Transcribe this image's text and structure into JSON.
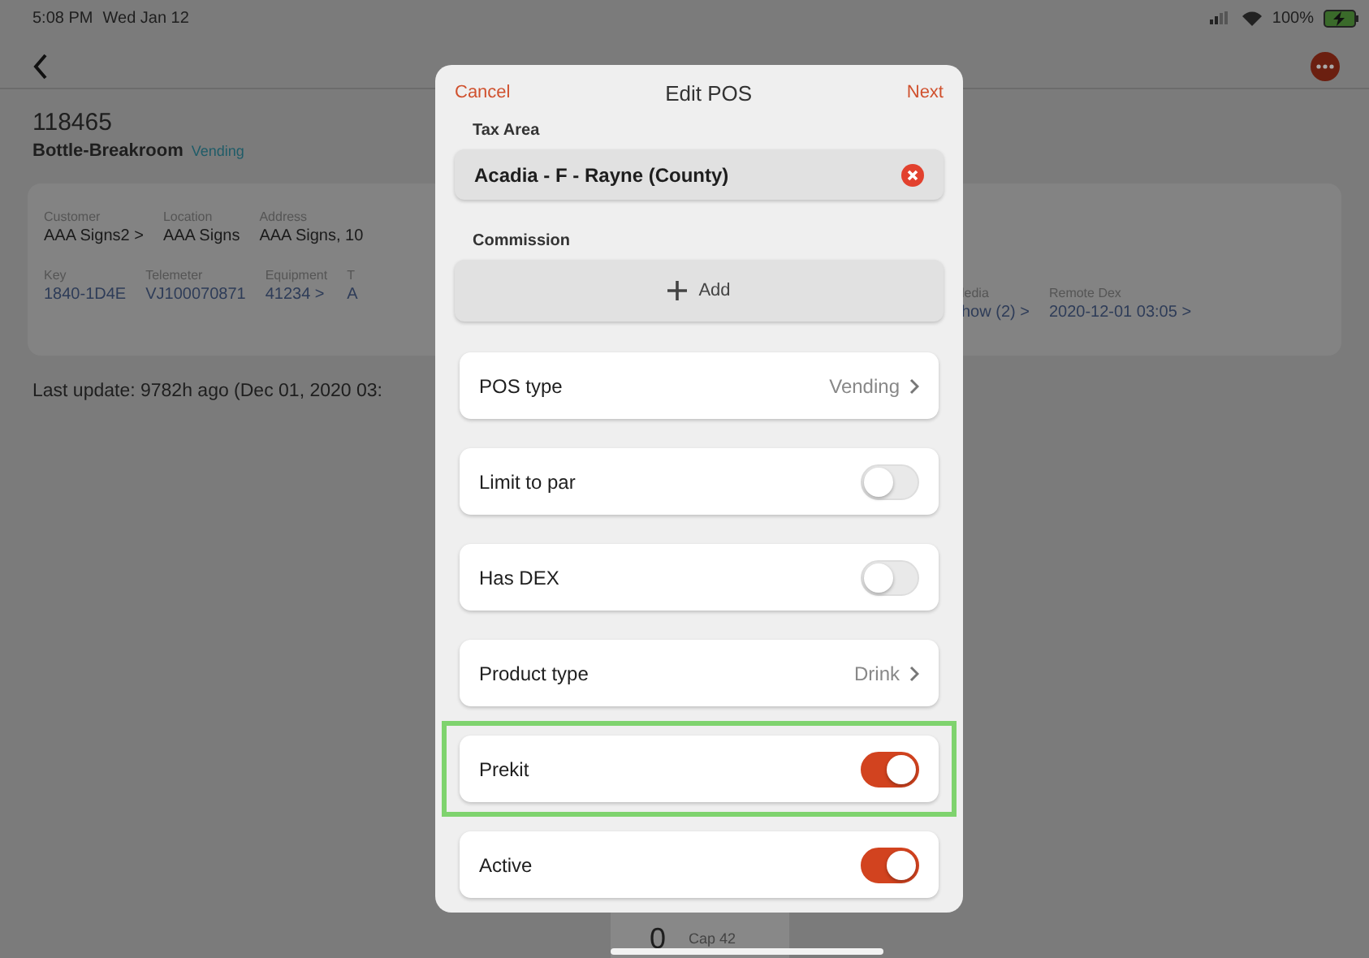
{
  "status_bar": {
    "time": "5:08 PM",
    "date": "Wed Jan 12",
    "battery": "100%"
  },
  "pos": {
    "number": "118465",
    "name": "Bottle-Breakroom",
    "type": "Vending"
  },
  "details": [
    [
      {
        "label": "Customer",
        "value": "AAA Signs2 >",
        "link": false
      },
      {
        "label": "Location",
        "value": "AAA Signs",
        "link": false
      },
      {
        "label": "Address",
        "value": "AAA Signs, 10",
        "link": false
      }
    ],
    [
      {
        "label": "Key",
        "value": "1840-1D4E",
        "link": true
      },
      {
        "label": "Telemeter",
        "value": "VJ100070871",
        "link": true
      },
      {
        "label": "Equipment",
        "value": "41234 >",
        "link": true
      },
      {
        "label": "T",
        "value": "A",
        "link": true
      }
    ]
  ],
  "details_right": [
    {
      "label": "ledia",
      "value": "how (2) >"
    },
    {
      "label": "Remote Dex",
      "value": "2020-12-01 03:05 >"
    }
  ],
  "last_update": "Last update: 9782h ago (Dec 01, 2020 03:",
  "bottom_card": {
    "count": "0",
    "cap": "Cap 42"
  },
  "modal": {
    "cancel": "Cancel",
    "title": "Edit POS",
    "next": "Next",
    "tax_area": {
      "label": "Tax Area",
      "value": "Acadia - F - Rayne (County)"
    },
    "commission": {
      "label": "Commission",
      "add": "Add"
    },
    "rows": [
      {
        "kind": "link",
        "label": "POS type",
        "value": "Vending",
        "highlighted": false
      },
      {
        "kind": "toggle",
        "label": "Limit to par",
        "on": false,
        "highlighted": false
      },
      {
        "kind": "toggle",
        "label": "Has DEX",
        "on": false,
        "highlighted": false
      },
      {
        "kind": "link",
        "label": "Product type",
        "value": "Drink",
        "highlighted": false
      },
      {
        "kind": "toggle",
        "label": "Prekit",
        "on": true,
        "highlighted": true
      },
      {
        "kind": "toggle",
        "label": "Active",
        "on": true,
        "highlighted": false
      }
    ]
  }
}
